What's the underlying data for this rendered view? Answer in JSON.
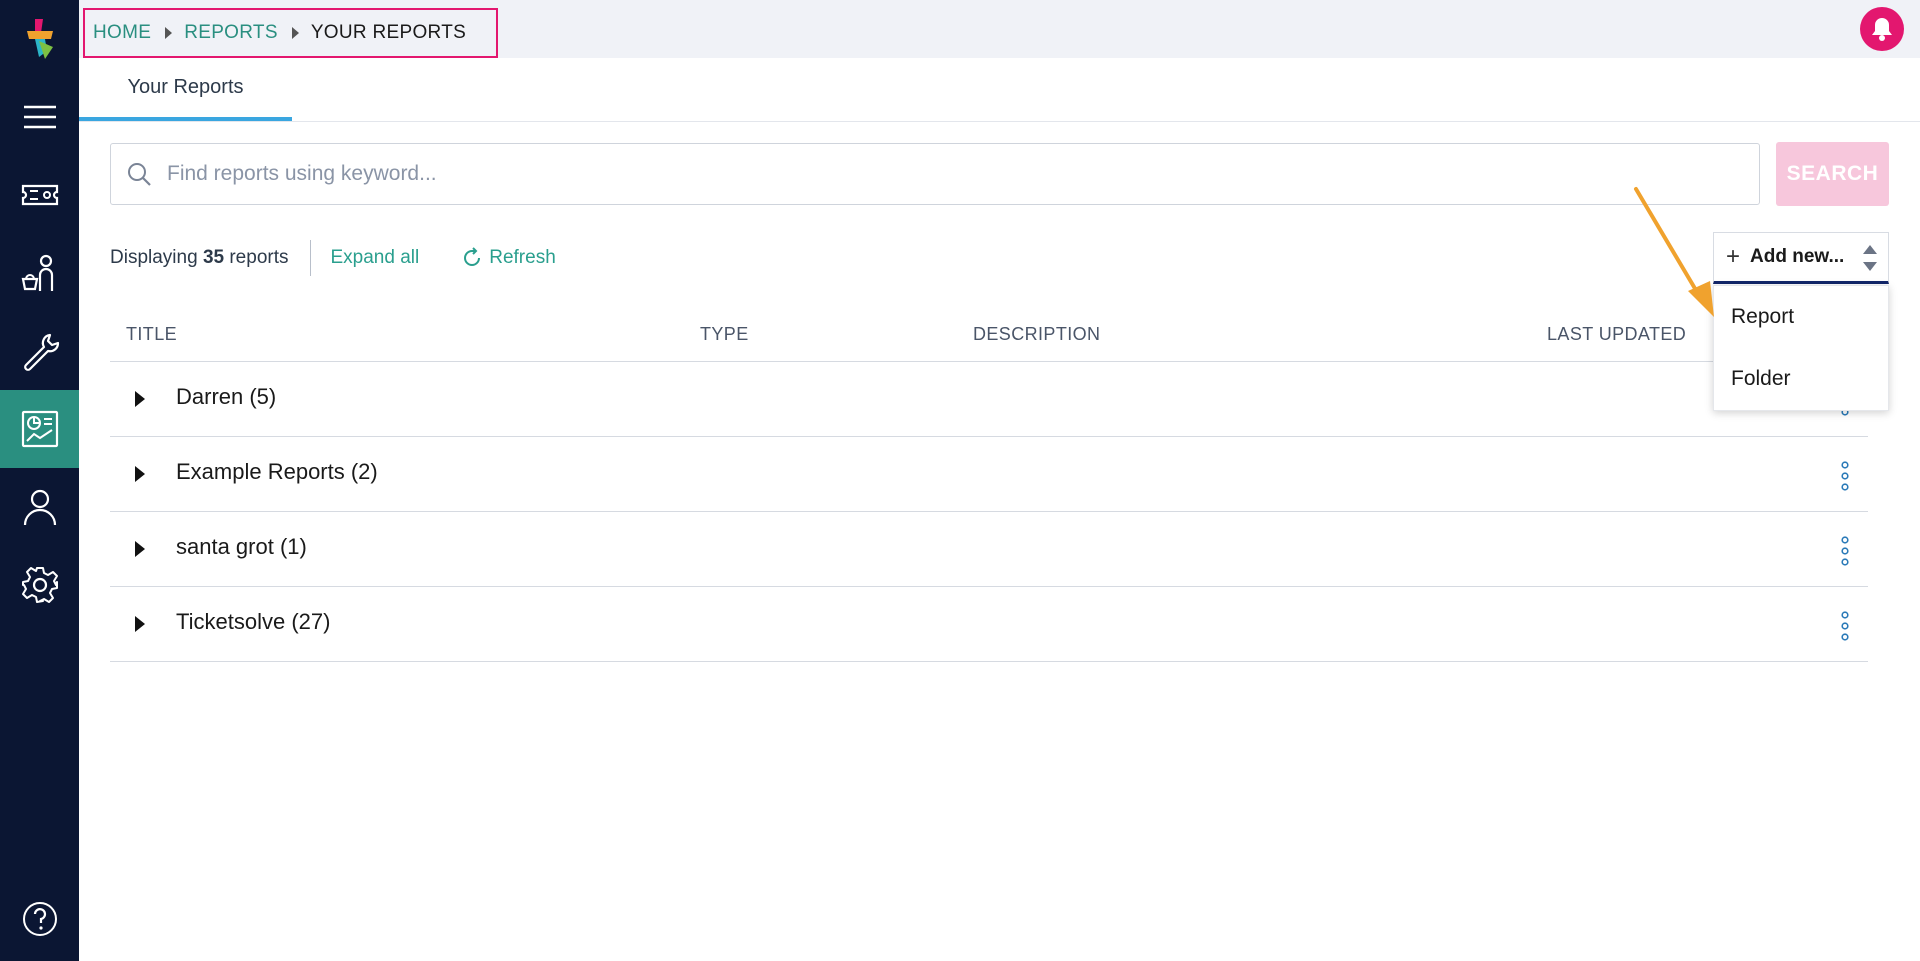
{
  "breadcrumb": [
    {
      "label": "HOME",
      "current": false
    },
    {
      "label": "REPORTS",
      "current": false
    },
    {
      "label": "YOUR REPORTS",
      "current": true
    }
  ],
  "tabs": [
    {
      "label": "Your Reports",
      "active": true
    }
  ],
  "search": {
    "placeholder": "Find reports using keyword...",
    "value": "",
    "button_label": "SEARCH"
  },
  "toolbar": {
    "displaying_prefix": "Displaying",
    "report_count": "35",
    "displaying_suffix": "reports",
    "expand_all": "Expand all",
    "refresh": "Refresh"
  },
  "add_new": {
    "label": "Add new...",
    "options": [
      "Report",
      "Folder"
    ]
  },
  "table": {
    "columns": [
      "TITLE",
      "TYPE",
      "DESCRIPTION",
      "LAST UPDATED"
    ],
    "rows": [
      {
        "title": "Darren (5)"
      },
      {
        "title": "Example Reports (2)"
      },
      {
        "title": "santa grot (1)"
      },
      {
        "title": "Ticketsolve (27)"
      }
    ]
  },
  "sidebar": {
    "items": [
      "menu-icon",
      "ticket-icon",
      "customers-icon",
      "tools-icon",
      "reports-icon",
      "user-icon",
      "settings-icon"
    ],
    "active": "reports-icon",
    "help": "help-icon"
  },
  "colors": {
    "sidebar_bg": "#0b1633",
    "active_item": "#2a8f80",
    "accent_link": "#2a9f8e",
    "brand_pink": "#e3176f",
    "search_button": "#f7c7dc",
    "tab_underline": "#3aa6e0",
    "annotation_arrow": "#f0a22e"
  }
}
